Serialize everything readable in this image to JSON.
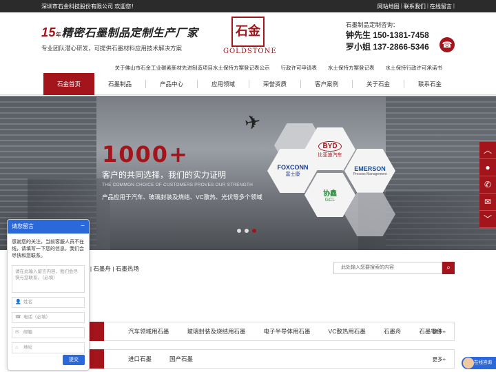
{
  "topbar": {
    "welcome": "深圳市石金科技股份有限公司 欢迎您！",
    "links": [
      "网站地图",
      "联系我们",
      "在线留言"
    ]
  },
  "header": {
    "slogan_num": "15",
    "slogan_year": "年",
    "slogan_main": "精密石墨制品定制生产厂家",
    "slogan_sub": "专业团队潜心研发，可提供石墨材料应用技术解决方案",
    "logo_char": "石金",
    "logo_word": "GOLDSTONE",
    "contact_title": "石墨制品定制咨询：",
    "contact_1": "钟先生 150-1381-7458",
    "contact_2": "罗小姐 137-2866-5346"
  },
  "sublinks": [
    "关于佛山市石金工业碳素新材先进制造项目水土保持方案登记表公示",
    "行政许可申请表",
    "水土保持方案登记表",
    "水土保持行政许可承诺书"
  ],
  "nav": [
    "石金首页",
    "石墨制品",
    "产品中心",
    "应用领域",
    "荣誉资质",
    "客户案例",
    "关于石金",
    "联系石金"
  ],
  "banner": {
    "number": "1000+",
    "headline": "客户的共同选择，我们的实力证明",
    "english": "THE COMMON CHOICE OF CUSTOMERS PROVES OUR STRENGTH",
    "desc": "产品应用于汽车、玻璃封装及烧结、VC散热、光伏等多个领域",
    "brands": [
      {
        "name": "BYD",
        "sub": "比亚迪汽车"
      },
      {
        "name": "FOXCONN",
        "sub": "富士康"
      },
      {
        "name": "EMERSON",
        "sub": "Process Management"
      },
      {
        "name": "协鑫",
        "sub": "GCL"
      }
    ]
  },
  "right_bar_icons": [
    "arrow-up-icon",
    "qq-icon",
    "phone-icon",
    "wechat-icon",
    "arrow-down-icon"
  ],
  "hot": {
    "text": "墨 | 石墨舟 | 石墨热场"
  },
  "search": {
    "placeholder": "此处输入您要搜索的内容"
  },
  "categories": [
    {
      "items": [
        "汽车领域用石墨",
        "玻璃封装及烧结用石墨",
        "电子半导体用石墨",
        "VC散热用石墨",
        "石墨舟",
        "石墨零件"
      ],
      "more": "更多+"
    },
    {
      "items": [
        "进口石墨",
        "国产石墨"
      ],
      "more": "更多+"
    }
  ],
  "chat": {
    "title": "请您留言",
    "message": "感谢您的关注，当前客服人员不在线，请填写一下您的信息，我们会尽快和您联系。",
    "textarea_placeholder": "请在此输入留言内容，我们会尽快与您联系。（必填）",
    "fields": [
      "姓名",
      "电话（必填）",
      "邮箱",
      "地址"
    ],
    "send": "提交"
  },
  "online": "在线咨询",
  "colors": {
    "brand": "#a3141b",
    "chat_blue": "#2b68d9",
    "topbar": "#2b2b2b"
  }
}
